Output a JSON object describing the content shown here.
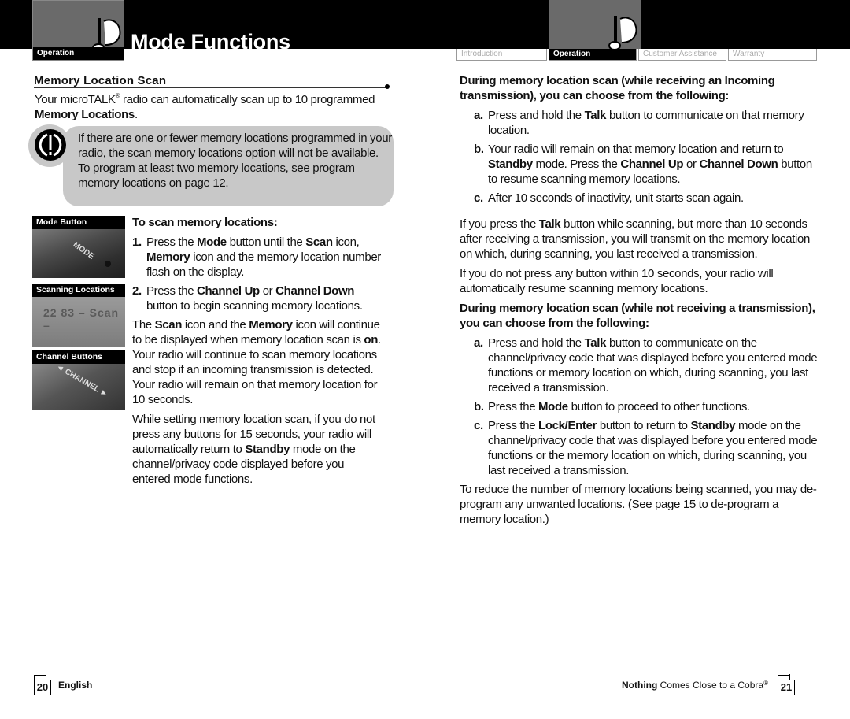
{
  "header": {
    "section_tab_label": "Operation",
    "page_title": "Mode Functions",
    "nav_tabs": [
      {
        "label": "Introduction",
        "active": false
      },
      {
        "label": "Operation",
        "active": true
      },
      {
        "label": "Customer Assistance",
        "active": false
      },
      {
        "label": "Warranty",
        "active": false
      }
    ],
    "icon": "headset-icon"
  },
  "left_page": {
    "section_heading": "Memory Location Scan",
    "intro": {
      "pre": "Your microTALK",
      "reg": "®",
      "mid": " radio can automatically scan up to 10 programmed ",
      "bold": "Memory Locations",
      "post": "."
    },
    "note": {
      "icon": "caution-icon",
      "text": "If there are one or fewer memory locations programmed in your radio, the scan memory locations option will not be available. To program at least two memory locations, see program memory locations on page 12."
    },
    "images": [
      {
        "label": "Mode Button",
        "photo_text": "MODE"
      },
      {
        "label": "Scanning Locations",
        "photo_text": "22 83 – Scan –"
      },
      {
        "label": "Channel Buttons",
        "photo_text": "◄ CHANNEL ►"
      }
    ],
    "steps_heading": "To scan memory locations:",
    "steps": [
      {
        "num": "1.",
        "parts": [
          {
            "t": "Press the ",
            "b": false
          },
          {
            "t": "Mode",
            "b": true
          },
          {
            "t": " button until the ",
            "b": false
          },
          {
            "t": "Scan",
            "b": true
          },
          {
            "t": " icon, ",
            "b": false
          },
          {
            "t": "Memory",
            "b": true
          },
          {
            "t": " icon and the memory location number flash on the display.",
            "b": false
          }
        ]
      },
      {
        "num": "2.",
        "parts": [
          {
            "t": "Press the ",
            "b": false
          },
          {
            "t": "Channel Up",
            "b": true
          },
          {
            "t": " or ",
            "b": false
          },
          {
            "t": "Channel Down",
            "b": true
          },
          {
            "t": " button to begin scanning memory locations.",
            "b": false
          }
        ]
      }
    ],
    "paragraphs": [
      [
        {
          "t": "The ",
          "b": false
        },
        {
          "t": "Scan",
          "b": true
        },
        {
          "t": " icon and the ",
          "b": false
        },
        {
          "t": "Memory",
          "b": true
        },
        {
          "t": " icon will continue to be displayed when memory location scan is ",
          "b": false
        },
        {
          "t": "on",
          "b": true
        },
        {
          "t": ". Your radio will continue to scan memory locations and stop if an incoming transmission is detected. Your radio will remain on that memory location for 10 seconds.",
          "b": false
        }
      ],
      [
        {
          "t": "While setting memory location scan, if you do not press any buttons for 15 seconds, your radio will automatically return to ",
          "b": false
        },
        {
          "t": "Standby",
          "b": true
        },
        {
          "t": " mode on the channel/privacy code displayed before you entered mode functions.",
          "b": false
        }
      ]
    ]
  },
  "right_page": {
    "blocks": [
      {
        "type": "heading",
        "text": "During memory location scan (while receiving an Incoming transmission), you can choose from the following:"
      },
      {
        "type": "item",
        "letter": "a.",
        "parts": [
          {
            "t": "Press and hold the ",
            "b": false
          },
          {
            "t": "Talk",
            "b": true
          },
          {
            "t": " button to communicate on that memory location.",
            "b": false
          }
        ]
      },
      {
        "type": "item",
        "letter": "b.",
        "parts": [
          {
            "t": "Your radio will remain on that memory location and return to ",
            "b": false
          },
          {
            "t": "Standby",
            "b": true
          },
          {
            "t": " mode. Press the ",
            "b": false
          },
          {
            "t": "Channel Up",
            "b": true
          },
          {
            "t": " or ",
            "b": false
          },
          {
            "t": "Channel Down",
            "b": true
          },
          {
            "t": " button to resume scanning memory locations.",
            "b": false
          }
        ]
      },
      {
        "type": "item",
        "letter": "c.",
        "parts": [
          {
            "t": "After 10 seconds of inactivity, unit starts scan again.",
            "b": false
          }
        ]
      },
      {
        "type": "para",
        "gap": true,
        "parts": [
          {
            "t": "If you press the ",
            "b": false
          },
          {
            "t": "Talk",
            "b": true
          },
          {
            "t": " button while scanning, but more than 10 seconds after receiving a transmission, you will transmit on the memory location on which, during scanning, you last received a transmission.",
            "b": false
          }
        ]
      },
      {
        "type": "para",
        "parts": [
          {
            "t": "If you do not press any button within 10 seconds, your radio will automatically resume scanning memory locations.",
            "b": false
          }
        ]
      },
      {
        "type": "heading",
        "text": "During memory location scan (while not receiving a transmission), you can choose from the following:"
      },
      {
        "type": "item",
        "letter": "a.",
        "parts": [
          {
            "t": "Press and hold the ",
            "b": false
          },
          {
            "t": "Talk",
            "b": true
          },
          {
            "t": " button to communicate on the channel/privacy code that was displayed before you entered mode functions or memory location on which, during scanning, you last received a transmission.",
            "b": false
          }
        ]
      },
      {
        "type": "item",
        "letter": "b.",
        "parts": [
          {
            "t": "Press the ",
            "b": false
          },
          {
            "t": "Mode",
            "b": true
          },
          {
            "t": " button to proceed to other functions.",
            "b": false
          }
        ]
      },
      {
        "type": "item",
        "letter": "c.",
        "parts": [
          {
            "t": "Press the ",
            "b": false
          },
          {
            "t": "Lock/Enter",
            "b": true
          },
          {
            "t": " button to return to ",
            "b": false
          },
          {
            "t": "Standby",
            "b": true
          },
          {
            "t": " mode on the channel/privacy code that was displayed before you entered mode functions or the memory location on which, during scanning, you last received a transmission.",
            "b": false
          }
        ]
      },
      {
        "type": "para",
        "parts": [
          {
            "t": "To reduce the number of memory locations being scanned, you may de-program any unwanted locations. (See page 15 to de-program a memory location.)",
            "b": false
          }
        ]
      }
    ]
  },
  "footer": {
    "left_page_number": "20",
    "language": "English",
    "slogan_bold": "Nothing",
    "slogan_rest": " Comes Close to a Cobra",
    "slogan_reg": "®",
    "right_page_number": "21"
  }
}
